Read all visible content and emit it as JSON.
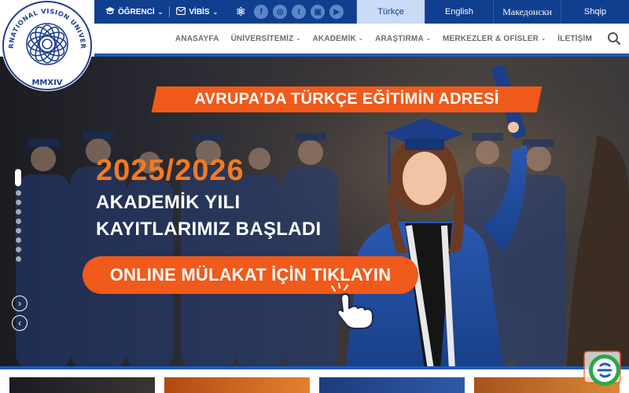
{
  "topbar": {
    "student_label": "ÖĞRENCİ",
    "vibis_label": "VİBİS",
    "socials": [
      {
        "icon": "atom-icon"
      },
      {
        "icon": "facebook-icon",
        "glyph": "f"
      },
      {
        "icon": "instagram-icon",
        "glyph": "◎"
      },
      {
        "icon": "twitter-icon",
        "glyph": "t"
      },
      {
        "icon": "linkedin-icon",
        "glyph": "▣"
      },
      {
        "icon": "youtube-icon",
        "glyph": "▶"
      }
    ],
    "languages": [
      {
        "label": "Türkçe",
        "active": true
      },
      {
        "label": "English",
        "active": false
      },
      {
        "label": "Македонски",
        "active": false
      },
      {
        "label": "Shqip",
        "active": false
      }
    ]
  },
  "logo": {
    "arc_text": "INTERNATIONAL VISION UNIVERSITY",
    "year_text": "MMXIV"
  },
  "nav": {
    "items": [
      {
        "label": "ANASAYFA",
        "dropdown": false
      },
      {
        "label": "ÜNİVERSİTEMİZ",
        "dropdown": true
      },
      {
        "label": "AKADEMİK",
        "dropdown": true
      },
      {
        "label": "ARAŞTIRMA",
        "dropdown": true
      },
      {
        "label": "MERKEZLER & OFİSLER",
        "dropdown": true
      },
      {
        "label": "İLETİŞİM",
        "dropdown": false
      }
    ]
  },
  "hero": {
    "banner": "AVRUPA’DA TÜRKÇE EĞİTİMİN ADRESİ",
    "year": "2025/2026",
    "line1": "AKADEMİK YILI",
    "line2": "KAYITLARIMIZ BAŞLADI",
    "cta": "ONLINE MÜLAKAT İÇİN TIKLAYIN",
    "slide_count": 9,
    "active_slide": 1
  },
  "colors": {
    "brand_blue": "#103f8f",
    "accent_orange": "#f05a1a",
    "year_orange": "#f47a22"
  }
}
